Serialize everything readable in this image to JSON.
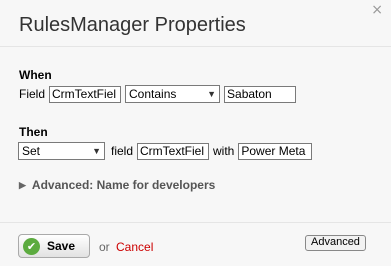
{
  "dialog": {
    "title": "RulesManager Properties",
    "close_glyph": "×"
  },
  "when": {
    "label": "When",
    "field_prefix": "Field",
    "field_value": "CrmTextFiel",
    "operator": "Contains",
    "match_value": "Sabaton"
  },
  "then": {
    "label": "Then",
    "action": "Set",
    "field_word": "field",
    "target_field": "CrmTextFiel",
    "with_word": "with",
    "set_value": "Power Meta"
  },
  "advanced_section": {
    "label": "Advanced: Name for developers"
  },
  "footer": {
    "save_label": "Save",
    "or_text": "or",
    "cancel_label": "Cancel",
    "advanced_button": "Advanced"
  },
  "icons": {
    "check": "check-icon",
    "caret": "chevron-down-icon",
    "expand": "triangle-right-icon"
  },
  "colors": {
    "cancel": "#cc0000",
    "save_check": "#5cab3f"
  }
}
